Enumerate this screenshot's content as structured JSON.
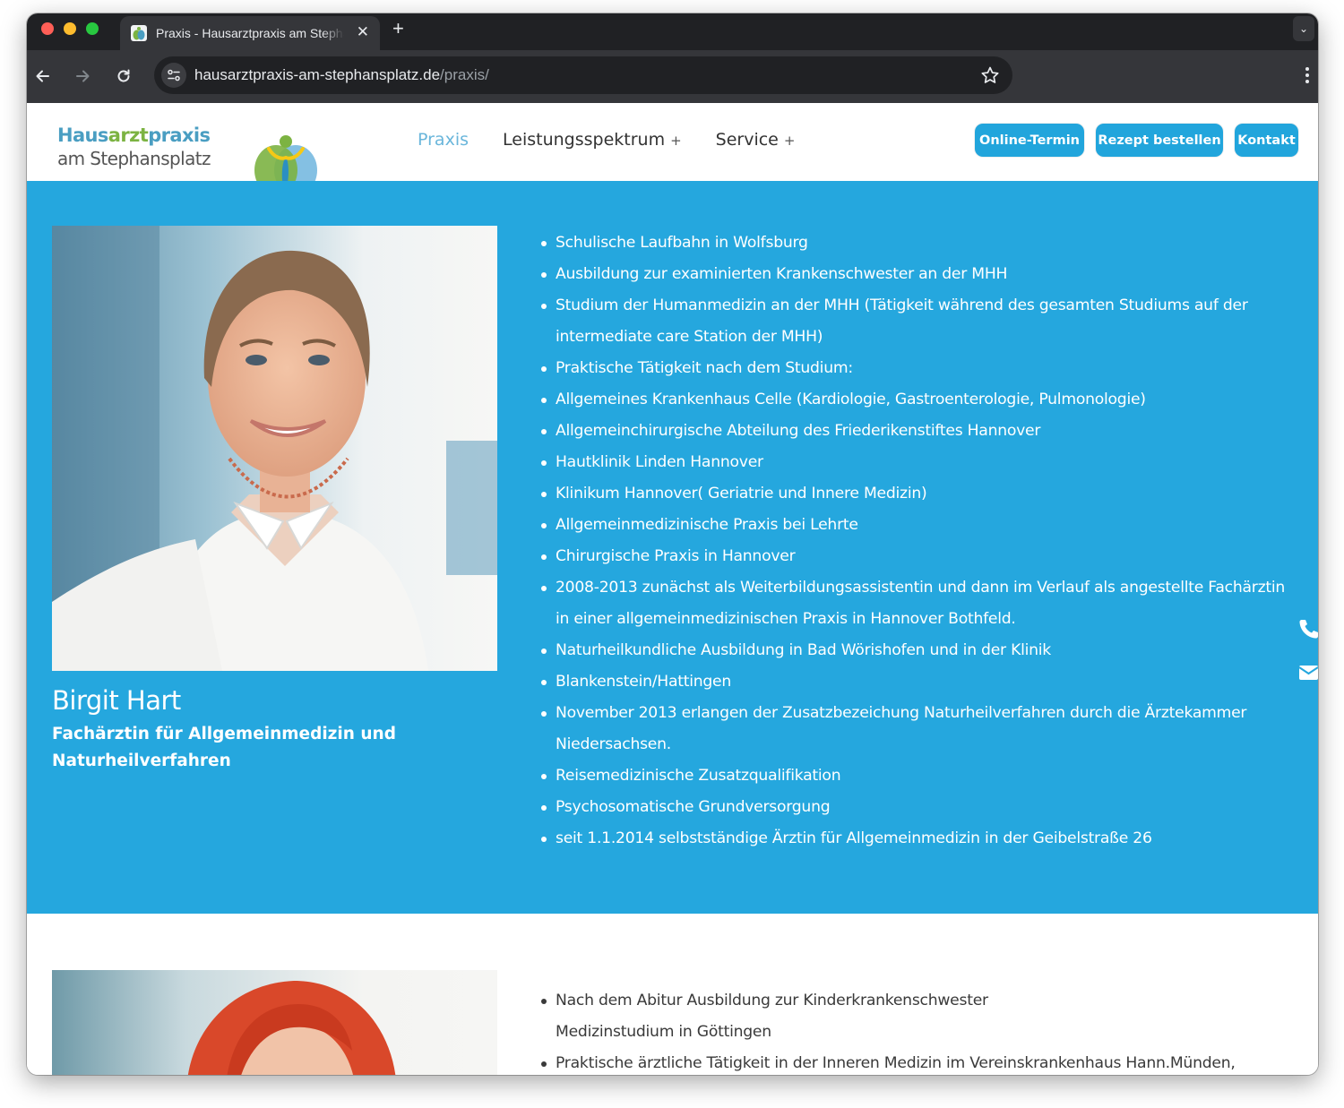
{
  "browser": {
    "tab_title": "Praxis - Hausarztpraxis am Stephansplatz",
    "url_host": "hausarztpraxis-am-stephansplatz.de",
    "url_path": "/praxis/",
    "close_glyph": "✕",
    "newtab_glyph": "+",
    "tabmenu_glyph": "⌄"
  },
  "logo": {
    "line1_part1": "Haus",
    "line1_part2": "arzt",
    "line1_part3": "praxis",
    "line2": "am Stephansplatz"
  },
  "nav": {
    "items": [
      {
        "label": "Praxis",
        "plus": ""
      },
      {
        "label": "Leistungsspektrum",
        "plus": "+"
      },
      {
        "label": "Service",
        "plus": "+"
      }
    ]
  },
  "cta": {
    "online": "Online-Termin",
    "rezept": "Rezept bestellen",
    "kontakt": "Kontakt"
  },
  "doctor1": {
    "name": "Birgit Hart",
    "title": "Fachärztin für Allgemeinmedizin und Naturheilverfahren",
    "cv": [
      "Schulische Laufbahn in Wolfsburg",
      "Ausbildung zur examinierten Krankenschwester an der MHH",
      "Studium der Humanmedizin an der MHH (Tätigkeit während des gesamten Studiums auf der intermediate care Station der MHH)",
      "Praktische Tätigkeit nach dem Studium:",
      "Allgemeines Krankenhaus Celle (Kardiologie, Gastroenterologie, Pulmonologie)",
      "Allgemeinchirurgische Abteilung des Friederikenstiftes Hannover",
      "Hautklinik Linden Hannover",
      "Klinikum Hannover( Geriatrie und Innere Medizin)",
      "Allgemeinmedizinische Praxis bei Lehrte",
      "Chirurgische Praxis in Hannover",
      "2008-2013 zunächst als Weiterbildungsassistentin und dann im Verlauf als angestellte Fachärztin in einer allgemeinmedizinischen Praxis in Hannover Bothfeld.",
      "Naturheilkundliche Ausbildung in Bad Wörishofen und in der Klinik",
      "Blankenstein/Hattingen",
      "November 2013 erlangen der Zusatzbezeichung Naturheilverfahren durch die Ärztekammer Niedersachsen.",
      "Reisemedizinische Zusatzqualifikation",
      "Psychosomatische Grundversorgung",
      "seit 1.1.2014 selbstständige Ärztin für Allgemeinmedizin in der Geibelstraße 26"
    ]
  },
  "doctor2": {
    "cv_line1": "Nach dem Abitur Ausbildung zur Kinderkrankenschwester",
    "cv_line1b": "Medizinstudium in Göttingen",
    "cv_line2": "Praktische ärztliche Tätigkeit in der Inneren Medizin im Vereinskrankenhaus Hann.Münden,"
  },
  "icons": {
    "back": "arrow-left-icon",
    "forward": "arrow-right-icon",
    "reload": "reload-icon",
    "site_info": "tune-icon",
    "bookmark": "star-icon",
    "menu": "kebab-icon",
    "phone": "phone-icon",
    "mail": "envelope-icon"
  },
  "colors": {
    "brand_blue": "#25a7de",
    "button_blue": "#21a5dc",
    "nav_active": "#6ab6db",
    "logo_blue": "#4a9ec2",
    "logo_green": "#7cb342"
  }
}
